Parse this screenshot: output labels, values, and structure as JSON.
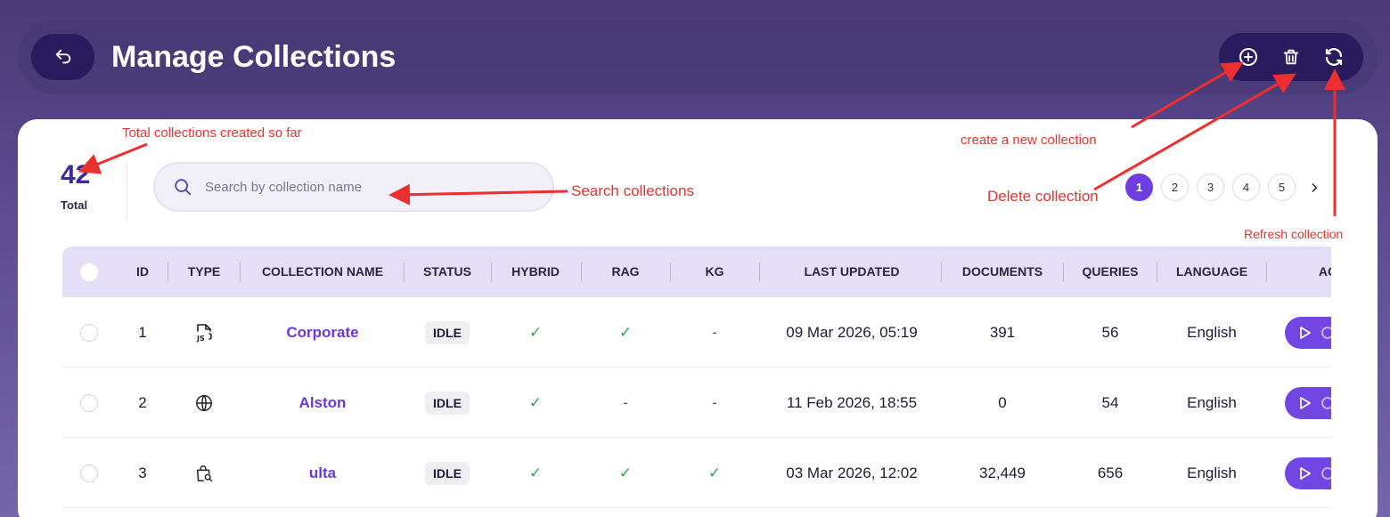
{
  "header": {
    "title": "Manage Collections"
  },
  "summary": {
    "total_count": "42",
    "total_label": "Total"
  },
  "search": {
    "placeholder": "Search by collection name"
  },
  "pagination": {
    "pages": [
      "1",
      "2",
      "3",
      "4",
      "5"
    ],
    "active_page": "1"
  },
  "table": {
    "columns": {
      "id": "ID",
      "type": "TYPE",
      "name": "COLLECTION NAME",
      "status": "STATUS",
      "hybrid": "HYBRID",
      "rag": "RAG",
      "kg": "KG",
      "last_updated": "LAST UPDATED",
      "documents": "DOCUMENTS",
      "queries": "QUERIES",
      "language": "LANGUAGE",
      "actions": "AC"
    },
    "rows": [
      {
        "id": "1",
        "type_icon": "js-file-icon",
        "name": "Corporate",
        "status": "IDLE",
        "hybrid": "✓",
        "rag": "✓",
        "kg": "-",
        "last_updated": "09 Mar 2026, 05:19",
        "documents": "391",
        "queries": "56",
        "language": "English"
      },
      {
        "id": "2",
        "type_icon": "globe-icon",
        "name": "Alston",
        "status": "IDLE",
        "hybrid": "✓",
        "rag": "-",
        "kg": "-",
        "last_updated": "11 Feb 2026, 18:55",
        "documents": "0",
        "queries": "54",
        "language": "English"
      },
      {
        "id": "3",
        "type_icon": "shopping-bag-search-icon",
        "name": "ulta",
        "status": "IDLE",
        "hybrid": "✓",
        "rag": "✓",
        "kg": "✓",
        "last_updated": "03 Mar 2026, 12:02",
        "documents": "32,449",
        "queries": "656",
        "language": "English"
      }
    ]
  },
  "annotations": {
    "total": "Total collections created so far",
    "search": "Search collections",
    "create": "create a new collection",
    "delete": "Delete collection",
    "refresh": "Refresh collection"
  },
  "icons": {
    "back": "back-arrow-icon",
    "add": "plus-circle-icon",
    "delete": "trash-icon",
    "refresh": "refresh-icon",
    "search": "search-icon",
    "next": "chevron-right-icon",
    "play": "play-icon"
  },
  "colors": {
    "accent": "#6d3fe0",
    "header_bg": "#2a1a5e",
    "annotation": "#ee2f2f",
    "check": "#2fa84f"
  }
}
